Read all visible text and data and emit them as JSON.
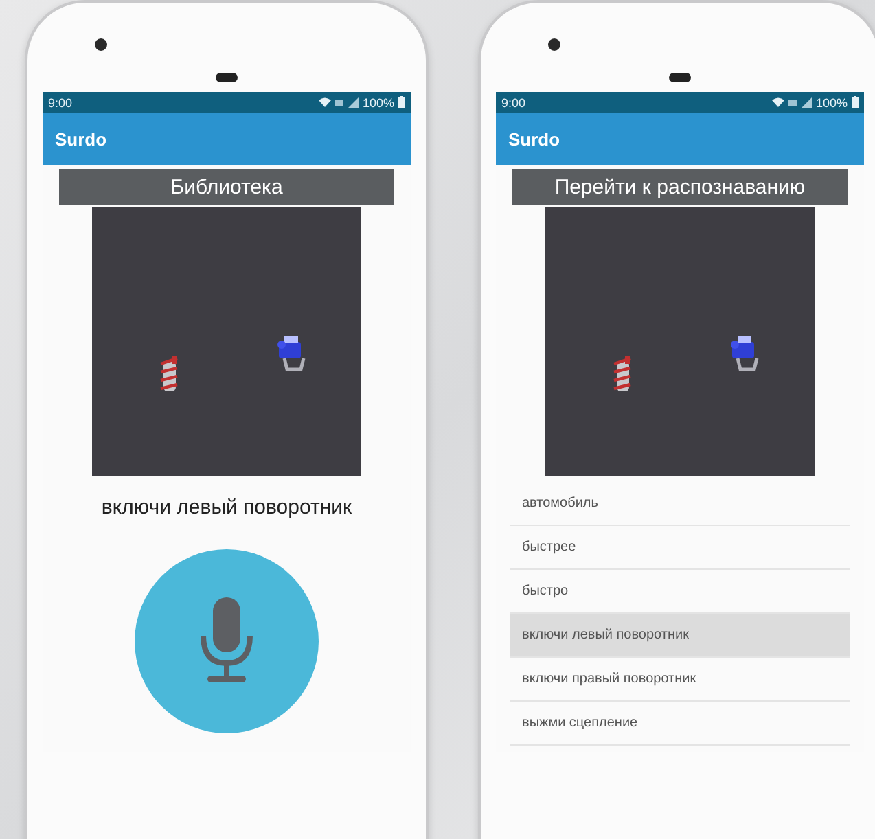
{
  "phones": [
    {
      "status_bar": {
        "time": "9:00",
        "battery": "100%"
      },
      "app_bar": {
        "title": "Surdo"
      },
      "screen": {
        "kind": "recognition",
        "action_button": "Библиотека",
        "caption": "включи левый поворотник"
      }
    },
    {
      "status_bar": {
        "time": "9:00",
        "battery": "100%"
      },
      "app_bar": {
        "title": "Surdo"
      },
      "screen": {
        "kind": "library",
        "action_button": "Перейти к распознаванию",
        "items": [
          {
            "label": "автомобиль",
            "selected": false
          },
          {
            "label": "быстрее",
            "selected": false
          },
          {
            "label": "быстро",
            "selected": false
          },
          {
            "label": "включи левый поворотник",
            "selected": true
          },
          {
            "label": "включи правый поворотник",
            "selected": false
          },
          {
            "label": "выжми сцепление",
            "selected": false
          }
        ]
      }
    }
  ]
}
